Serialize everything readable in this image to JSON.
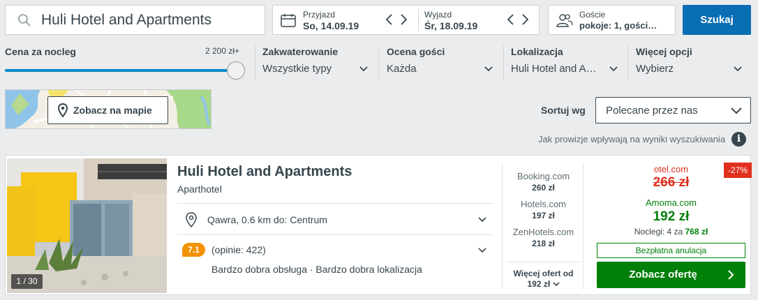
{
  "search": {
    "destination": "Huli Hotel and Apartments",
    "button": "Szukaj"
  },
  "dates": {
    "checkin_label": "Przyjazd",
    "checkin_value": "So, 14.09.19",
    "checkout_label": "Wyjazd",
    "checkout_value": "Śr, 18.09.19"
  },
  "guests": {
    "label": "Goście",
    "value": "pokoje: 1, gości…"
  },
  "filters": {
    "price_label": "Cena za nocleg",
    "price_max": "2 200 zł+",
    "price_level": 1.0,
    "stay_label": "Zakwaterowanie",
    "stay_value": "Wszystkie typy",
    "rating_label": "Ocena gości",
    "rating_value": "Każda",
    "location_label": "Lokalizacja",
    "location_value": "Huli Hotel and A…",
    "more_label": "Więcej opcji",
    "more_value": "Wybierz"
  },
  "map": {
    "button": "Zobacz na mapie"
  },
  "sort": {
    "label": "Sortuj wg",
    "value": "Polecane przez nas",
    "note": "Jak prowizje wpływają na wyniki wyszukiwania",
    "info": "i"
  },
  "result": {
    "name": "Huli Hotel and Apartments",
    "type": "Aparthotel",
    "location": "Qawra, 0.6 km do: Centrum",
    "rating": "7.1",
    "reviews": "(opinie: 422)",
    "features": "Bardzo dobra obsługa · Bardzo dobra lokalizacja",
    "photo_count": "1 / 30",
    "providers": [
      {
        "name": "Booking.com",
        "price": "260 zł"
      },
      {
        "name": "Hotels.com",
        "price": "197 zł"
      },
      {
        "name": "ZenHotels.com",
        "price": "218 zł"
      }
    ],
    "more_offers_line1": "Więcej ofert od",
    "more_offers_line2": "192 zł",
    "deal": {
      "discount": "-27%",
      "old_source": "otel.com",
      "old_price": "266 zł",
      "new_source": "Amoma.com",
      "new_price": "192 zł",
      "nights_prefix": "Noclegi: 4 za",
      "nights_total": "768 zł",
      "free_cancel": "Bezpłatna anulacja",
      "button": "Zobacz ofertę"
    }
  },
  "colors": {
    "accent": "#0a6eb4",
    "deal_green": "#008009",
    "discount_red": "#e0301e",
    "rating_orange": "#f39200"
  }
}
